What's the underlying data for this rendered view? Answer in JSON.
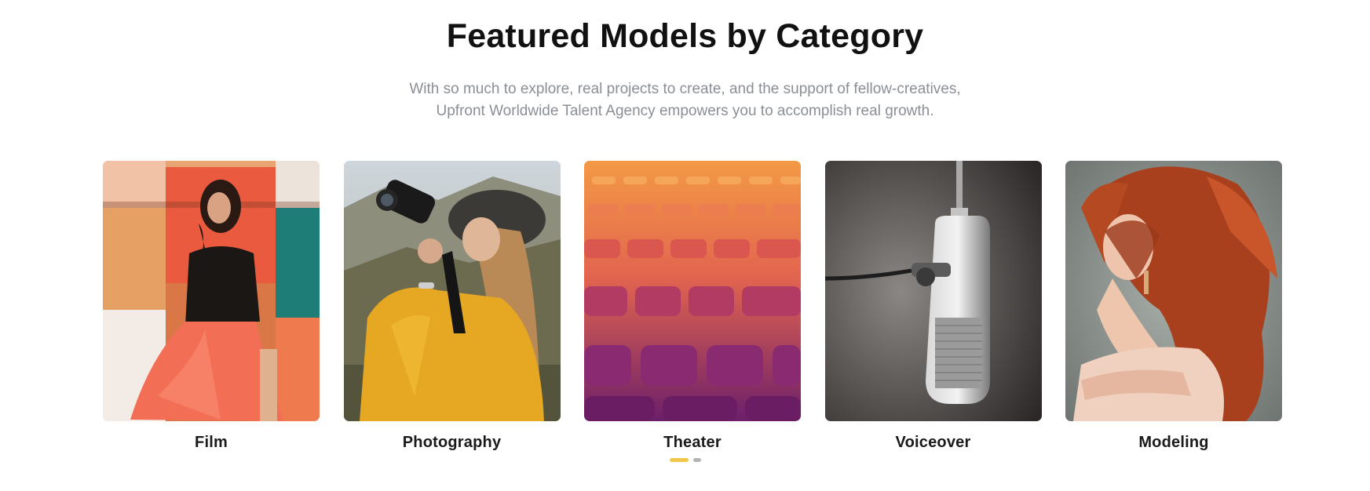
{
  "section": {
    "title": "Featured Models by Category",
    "subtitle_line1": "With so much to explore, real projects to create, and the support of fellow-creatives,",
    "subtitle_line2": "Upfront Worldwide Talent Agency empowers you to accomplish real growth."
  },
  "categories": [
    {
      "label": "Film",
      "image": "woman-in-orange-skirt-photo"
    },
    {
      "label": "Photography",
      "image": "woman-with-camera-photo"
    },
    {
      "label": "Theater",
      "image": "theater-seats-photo"
    },
    {
      "label": "Voiceover",
      "image": "studio-microphone-photo"
    },
    {
      "label": "Modeling",
      "image": "red-haired-model-photo"
    }
  ],
  "pagination": {
    "active_index": 0,
    "total": 2,
    "active_color": "#f3c74a",
    "inactive_color": "#b5b5b5"
  }
}
